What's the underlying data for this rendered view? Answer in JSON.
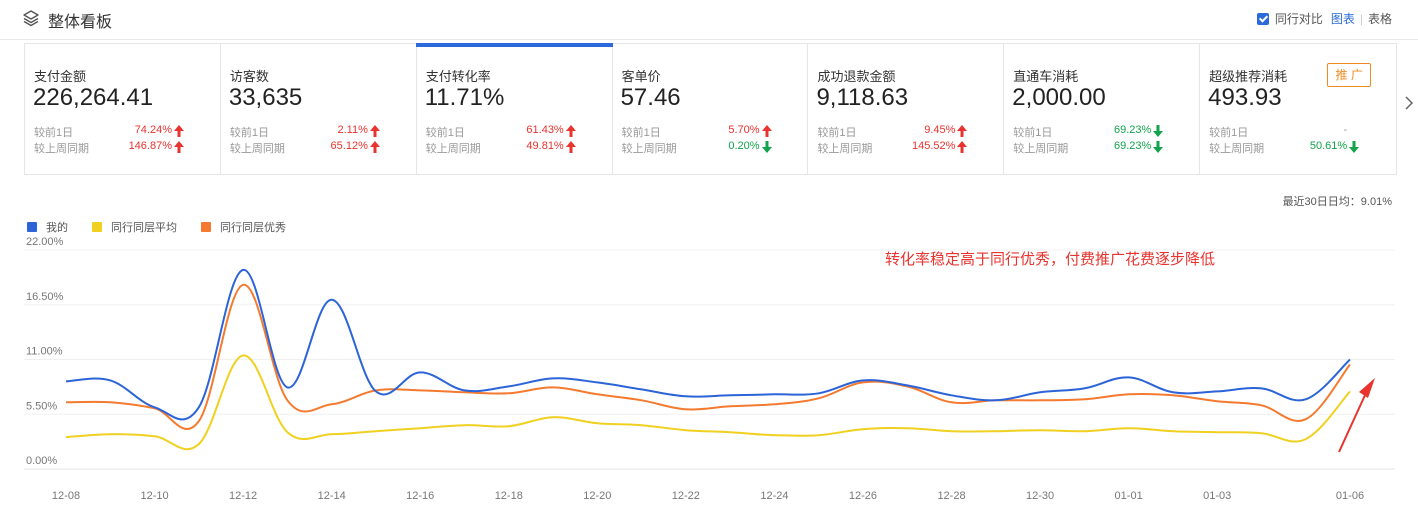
{
  "header": {
    "title": "整体看板",
    "compare_label": "同行对比",
    "chart_link": "图表",
    "separator": "|",
    "table_link": "表格"
  },
  "metrics": [
    {
      "label": "支付金额",
      "value": "226,264.41",
      "r1_label": "较前1日",
      "r1_pct": "74.24%",
      "r1_dir": "up",
      "r2_label": "较上周同期",
      "r2_pct": "146.87%",
      "r2_dir": "up"
    },
    {
      "label": "访客数",
      "value": "33,635",
      "r1_label": "较前1日",
      "r1_pct": "2.11%",
      "r1_dir": "up",
      "r2_label": "较上周同期",
      "r2_pct": "65.12%",
      "r2_dir": "up"
    },
    {
      "label": "支付转化率",
      "value": "11.71%",
      "r1_label": "较前1日",
      "r1_pct": "61.43%",
      "r1_dir": "up",
      "r2_label": "较上周同期",
      "r2_pct": "49.81%",
      "r2_dir": "up",
      "active": true
    },
    {
      "label": "客单价",
      "value": "57.46",
      "r1_label": "较前1日",
      "r1_pct": "5.70%",
      "r1_dir": "up",
      "r2_label": "较上周同期",
      "r2_pct": "0.20%",
      "r2_dir": "down"
    },
    {
      "label": "成功退款金额",
      "value": "9,118.63",
      "r1_label": "较前1日",
      "r1_pct": "9.45%",
      "r1_dir": "up",
      "r2_label": "较上周同期",
      "r2_pct": "145.52%",
      "r2_dir": "up"
    },
    {
      "label": "直通车消耗",
      "value": "2,000.00",
      "r1_label": "较前1日",
      "r1_pct": "69.23%",
      "r1_dir": "down",
      "r2_label": "较上周同期",
      "r2_pct": "69.23%",
      "r2_dir": "down"
    },
    {
      "label": "超级推荐消耗",
      "value": "493.93",
      "r1_label": "较前1日",
      "r1_pct": "-",
      "r1_dir": "none",
      "r2_label": "较上周同期",
      "r2_pct": "50.61%",
      "r2_dir": "down",
      "badge": "推 广"
    }
  ],
  "avg_text": "最近30日日均：9.01%",
  "annotation": "转化率稳定高于同行优秀，付费推广花费逐步降低",
  "colors": {
    "accent": "#2a6ad9",
    "up": "#e8332e",
    "down": "#12a34c"
  },
  "chart_data": {
    "type": "line",
    "x": [
      "12-08",
      "12-09",
      "12-10",
      "12-11",
      "12-12",
      "12-13",
      "12-14",
      "12-15",
      "12-16",
      "12-17",
      "12-18",
      "12-19",
      "12-20",
      "12-21",
      "12-22",
      "12-23",
      "12-24",
      "12-25",
      "12-26",
      "12-27",
      "12-28",
      "12-29",
      "12-30",
      "12-31",
      "01-01",
      "01-02",
      "01-03",
      "01-04",
      "01-05",
      "01-06"
    ],
    "x_tick_labels": [
      "12-08",
      "12-10",
      "12-12",
      "12-14",
      "12-16",
      "12-18",
      "12-20",
      "12-22",
      "12-24",
      "12-26",
      "12-28",
      "12-30",
      "01-01",
      "01-03",
      "01-06"
    ],
    "x_tick_positions": [
      0,
      2,
      4,
      6,
      8,
      10,
      12,
      14,
      16,
      18,
      20,
      22,
      24,
      26,
      29
    ],
    "y_tick_labels": [
      "0.00%",
      "5.50%",
      "11.00%",
      "16.50%",
      "22.00%"
    ],
    "ylim": [
      0,
      22
    ],
    "grid": true,
    "legend": "top-left",
    "series": [
      {
        "name": "我的",
        "color": "#2c64d8",
        "values": [
          8.8,
          8.9,
          6.2,
          6.2,
          20.0,
          8.2,
          17.0,
          7.8,
          9.7,
          7.9,
          8.3,
          9.1,
          8.7,
          8.0,
          7.3,
          7.4,
          7.5,
          7.6,
          8.9,
          8.4,
          7.4,
          6.9,
          7.7,
          8.1,
          9.2,
          7.7,
          7.8,
          8.1,
          7.0,
          11.0
        ]
      },
      {
        "name": "同行同层平均",
        "color": "#f0d020",
        "values": [
          3.2,
          3.5,
          3.3,
          2.5,
          11.4,
          3.7,
          3.5,
          3.8,
          4.1,
          4.4,
          4.3,
          5.2,
          4.6,
          4.4,
          3.9,
          3.7,
          3.4,
          3.4,
          4.0,
          4.1,
          3.8,
          3.8,
          3.9,
          3.8,
          4.1,
          3.8,
          3.7,
          3.6,
          3.0,
          7.8
        ]
      },
      {
        "name": "同行同层优秀",
        "color": "#f47a30",
        "values": [
          6.7,
          6.7,
          6.1,
          4.8,
          18.5,
          6.9,
          6.5,
          7.9,
          7.9,
          7.7,
          7.6,
          8.2,
          7.5,
          6.9,
          6.0,
          6.3,
          6.5,
          7.1,
          8.7,
          8.3,
          6.7,
          6.9,
          6.9,
          7.0,
          7.5,
          7.4,
          6.8,
          6.4,
          5.0,
          10.5
        ]
      }
    ]
  }
}
